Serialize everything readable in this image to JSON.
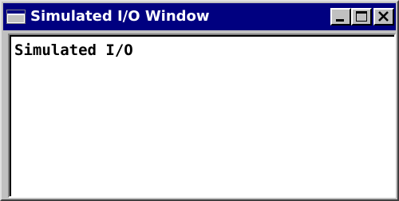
{
  "window": {
    "title": "Simulated I/O Window",
    "icon": "window-app-icon",
    "controls": {
      "minimize": "minimize-icon",
      "maximize": "maximize-icon",
      "close": "close-icon"
    },
    "colors": {
      "titlebar": "#000080",
      "title_text": "#ffffff",
      "frame": "#c0c0c0",
      "client_bg": "#ffffff"
    }
  },
  "output": {
    "text": "Simulated I/O"
  }
}
